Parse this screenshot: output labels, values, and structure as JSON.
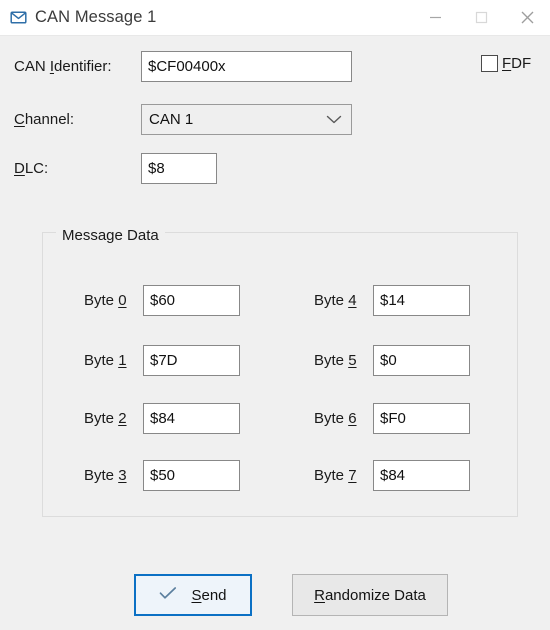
{
  "window": {
    "title": "CAN Message 1",
    "icon": "envelope-icon",
    "controls": {
      "minimize": "minimize-icon",
      "maximize": "maximize-icon",
      "close": "close-icon"
    }
  },
  "form": {
    "can_identifier": {
      "label_pre": "CAN ",
      "label_mnemonic": "I",
      "label_post": "dentifier:",
      "value": "$CF00400x"
    },
    "fdf": {
      "label_mnemonic": "F",
      "label_post": "DF",
      "checked": false
    },
    "channel": {
      "label_mnemonic": "C",
      "label_post": "hannel:",
      "value": "CAN 1",
      "options": [
        "CAN 1"
      ]
    },
    "dlc": {
      "label_mnemonic": "D",
      "label_post": "LC:",
      "value": "$8"
    }
  },
  "message_data": {
    "group_title": "Message Data",
    "bytes": [
      {
        "label_pre": "Byte ",
        "label_mnemonic": "0",
        "value": "$60"
      },
      {
        "label_pre": "Byte ",
        "label_mnemonic": "1",
        "value": "$7D"
      },
      {
        "label_pre": "Byte ",
        "label_mnemonic": "2",
        "value": "$84"
      },
      {
        "label_pre": "Byte ",
        "label_mnemonic": "3",
        "value": "$50"
      },
      {
        "label_pre": "Byte ",
        "label_mnemonic": "4",
        "value": "$14"
      },
      {
        "label_pre": "Byte ",
        "label_mnemonic": "5",
        "value": "$0"
      },
      {
        "label_pre": "Byte ",
        "label_mnemonic": "6",
        "value": "$F0"
      },
      {
        "label_pre": "Byte ",
        "label_mnemonic": "7",
        "value": "$84"
      }
    ]
  },
  "actions": {
    "send": {
      "icon": "check-icon",
      "label_mnemonic": "S",
      "label_post": "end"
    },
    "randomize": {
      "label_mnemonic": "R",
      "label_post": "andomize Data"
    }
  },
  "colors": {
    "background": "#f0f0f0",
    "titlebar": "#ffffff",
    "accent": "#0b70c4",
    "input_border": "#888888",
    "group_border": "#dcdcdc",
    "button_face": "#e1e1e1"
  }
}
